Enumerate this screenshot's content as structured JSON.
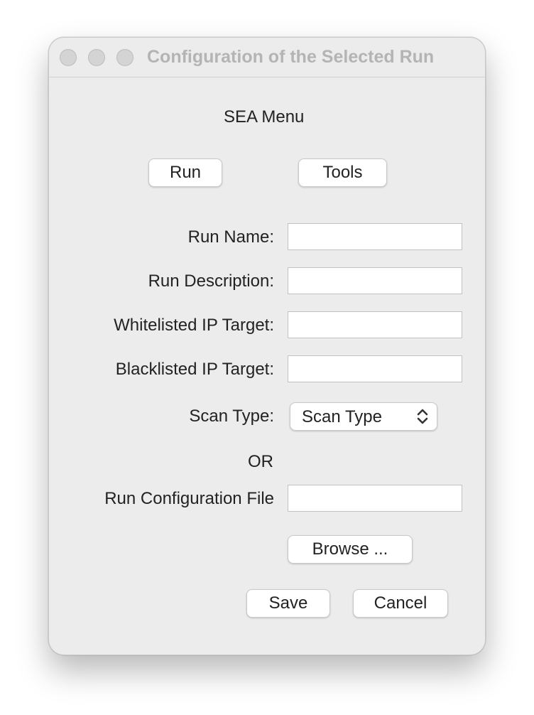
{
  "window": {
    "title": "Configuration of the Selected Run"
  },
  "menu": {
    "heading": "SEA Menu",
    "run_button": "Run",
    "tools_button": "Tools"
  },
  "form": {
    "run_name_label": "Run Name:",
    "run_name_value": "",
    "run_description_label": "Run Description:",
    "run_description_value": "",
    "whitelisted_label": "Whitelisted IP Target:",
    "whitelisted_value": "",
    "blacklisted_label": "Blacklisted IP Target:",
    "blacklisted_value": "",
    "scan_type_label": "Scan Type:",
    "scan_type_value": "Scan Type",
    "or_label": "OR",
    "config_file_label": "Run Configuration File",
    "config_file_value": "",
    "browse_button": "Browse ..."
  },
  "actions": {
    "save": "Save",
    "cancel": "Cancel"
  }
}
